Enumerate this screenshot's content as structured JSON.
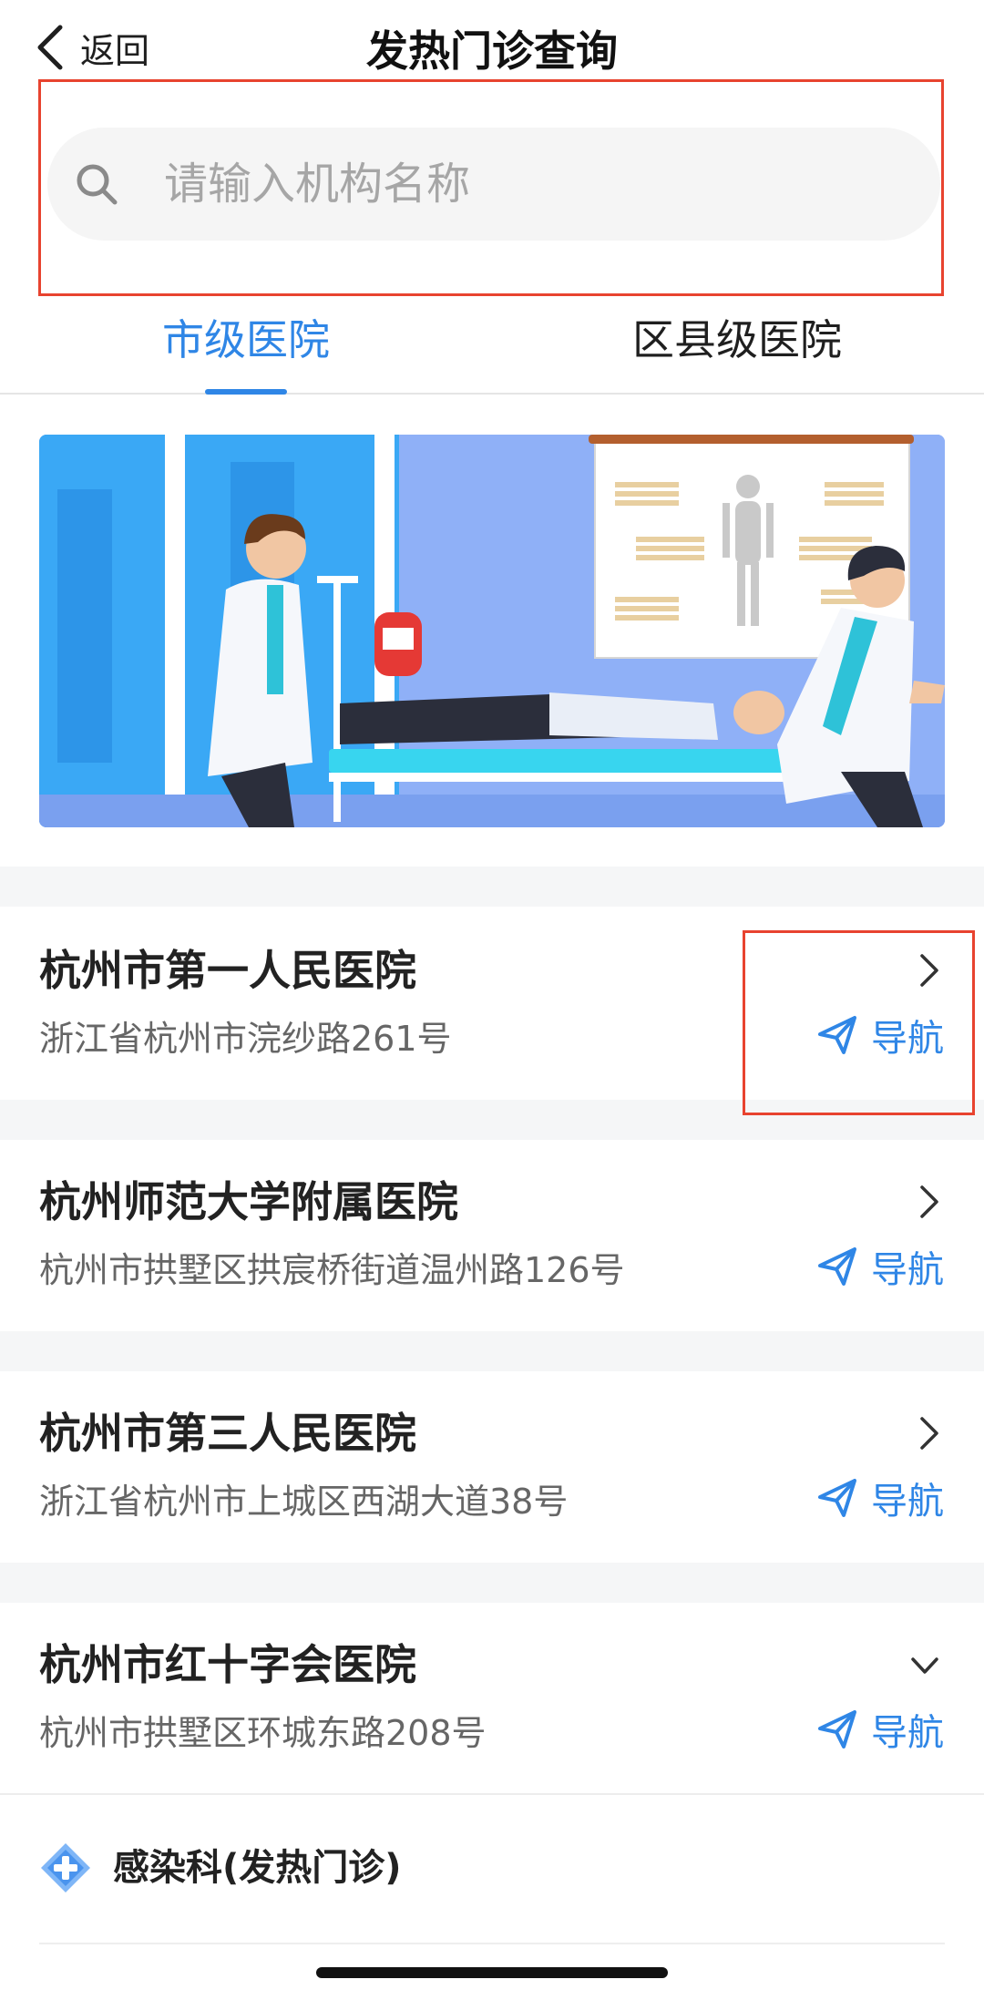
{
  "header": {
    "back_label": "返回",
    "title": "发热门诊查询"
  },
  "search": {
    "placeholder": "请输入机构名称",
    "value": ""
  },
  "tabs": [
    {
      "label": "市级医院",
      "active": true
    },
    {
      "label": "区县级医院",
      "active": false
    }
  ],
  "hospitals": [
    {
      "name": "杭州市第一人民医院",
      "address": "浙江省杭州市浣纱路261号",
      "nav_label": "导航",
      "expanded": false
    },
    {
      "name": "杭州师范大学附属医院",
      "address": "杭州市拱墅区拱宸桥街道温州路126号",
      "nav_label": "导航",
      "expanded": false
    },
    {
      "name": "杭州市第三人民医院",
      "address": "浙江省杭州市上城区西湖大道38号",
      "nav_label": "导航",
      "expanded": false
    },
    {
      "name": "杭州市红十字会医院",
      "address": "杭州市拱墅区环城东路208号",
      "nav_label": "导航",
      "expanded": true
    }
  ],
  "department": {
    "label": "感染科(发热门诊)"
  },
  "colors": {
    "accent": "#2f86e6",
    "highlight_box": "#e8432f"
  }
}
